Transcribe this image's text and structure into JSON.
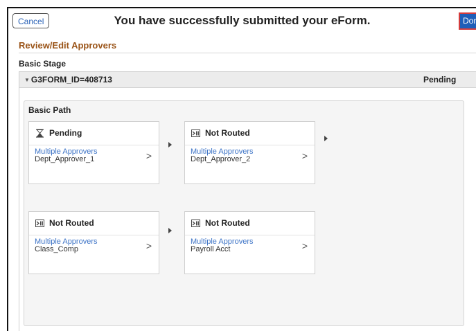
{
  "header": {
    "cancel_label": "Cancel",
    "title": "You have successfully submitted your eForm.",
    "done_label": "Done"
  },
  "section": {
    "title": "Review/Edit Approvers"
  },
  "stage": {
    "label": "Basic Stage",
    "form_id": "G3FORM_ID=408713",
    "status": "Pending"
  },
  "path": {
    "title": "Basic Path",
    "steps": [
      {
        "status": "Pending",
        "icon": "hourglass-icon",
        "approver_type": "Multiple Approvers",
        "approver": "Dept_Approver_1"
      },
      {
        "status": "Not Routed",
        "icon": "not-routed-icon",
        "approver_type": "Multiple Approvers",
        "approver": "Dept_Approver_2"
      },
      {
        "status": "Not Routed",
        "icon": "not-routed-icon",
        "approver_type": "Multiple Approvers",
        "approver": "Class_Comp"
      },
      {
        "status": "Not Routed",
        "icon": "not-routed-icon",
        "approver_type": "Multiple Approvers",
        "approver": "Payroll Acct"
      }
    ]
  },
  "colors": {
    "accent": "#9a5418",
    "link": "#3b72c6",
    "done_button": "#1f5eb8",
    "highlight_border": "#d43c3c"
  }
}
